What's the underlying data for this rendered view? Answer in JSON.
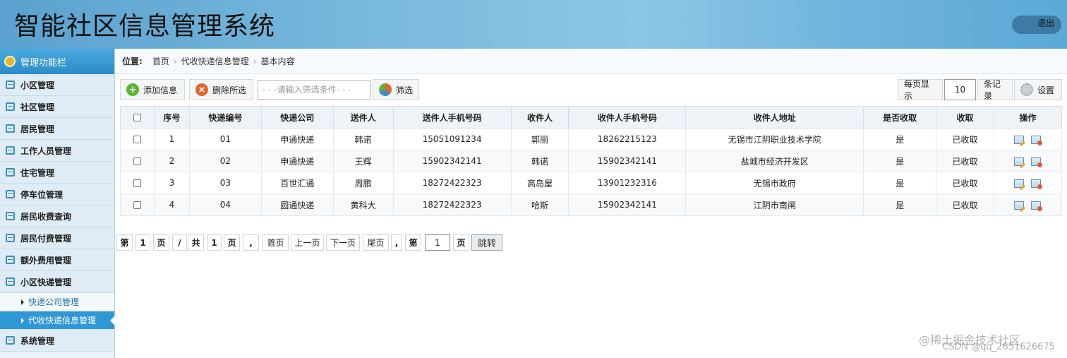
{
  "app": {
    "title": "智能社区信息管理系统",
    "logout_label": "退出"
  },
  "sidebar": {
    "header": "管理功能栏",
    "items": [
      {
        "label": "小区管理"
      },
      {
        "label": "社区管理"
      },
      {
        "label": "居民管理"
      },
      {
        "label": "工作人员管理"
      },
      {
        "label": "住宅管理"
      },
      {
        "label": "停车位管理"
      },
      {
        "label": "居民收费查询"
      },
      {
        "label": "居民付费管理"
      },
      {
        "label": "额外费用管理"
      },
      {
        "label": "小区快递管理"
      }
    ],
    "subitems": [
      {
        "label": "快递公司管理"
      },
      {
        "label": "代收快递信息管理"
      }
    ],
    "last_item": "系统管理"
  },
  "breadcrumb": {
    "label": "位置:",
    "items": [
      "首页",
      "代收快递信息管理",
      "基本内容"
    ]
  },
  "toolbar": {
    "add_label": "添加信息",
    "delete_label": "删除所选",
    "filter_placeholder": "- - -请输入筛选条件- - -",
    "filter_label": "筛选",
    "per_page_label": "每页显示",
    "per_page_value": "10",
    "records_label": "条记录",
    "settings_label": "设置"
  },
  "table": {
    "headers": [
      "序号",
      "快递编号",
      "快递公司",
      "送件人",
      "送件人手机号码",
      "收件人",
      "收件人手机号码",
      "收件人地址",
      "是否收取",
      "收取",
      "操作"
    ],
    "rows": [
      [
        "1",
        "01",
        "申通快递",
        "韩诺",
        "15051091234",
        "郭丽",
        "18262215123",
        "无锡市江阴职业技术学院",
        "是",
        "已收取"
      ],
      [
        "2",
        "02",
        "申通快递",
        "王辉",
        "15902342141",
        "韩诺",
        "15902342141",
        "盐城市经济开发区",
        "是",
        "已收取"
      ],
      [
        "3",
        "03",
        "百世汇通",
        "周鹏",
        "18272422323",
        "高岛屋",
        "13901232316",
        "无锡市政府",
        "是",
        "已收取"
      ],
      [
        "4",
        "04",
        "圆通快递",
        "黄科大",
        "18272422323",
        "哈斯",
        "15902342141",
        "江阴市南闸",
        "是",
        "已收取"
      ]
    ]
  },
  "pager": {
    "di": "第",
    "current": "1",
    "ye": "页",
    "slash": "/",
    "gong": "共",
    "total": "1",
    "ye2": "页",
    "comma": ",",
    "first": "首页",
    "prev": "上一页",
    "next": "下一页",
    "last": "尾页",
    "comma2": ",",
    "di2": "第",
    "jump_value": "1",
    "ye3": "页",
    "go": "跳转"
  },
  "watermark": {
    "line1": "@稀土掘金技术社区",
    "line2": "CSDN @qq_2651626675"
  }
}
